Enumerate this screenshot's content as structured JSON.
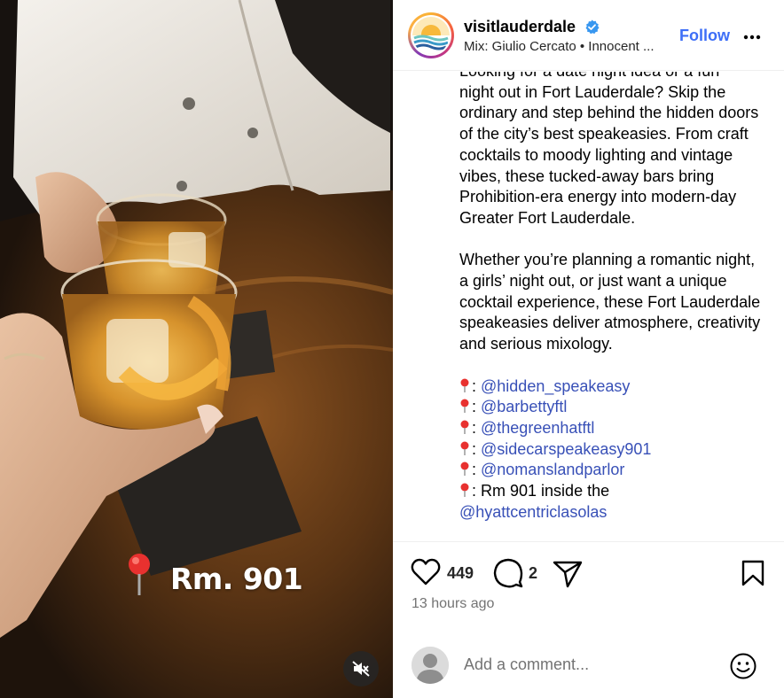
{
  "media": {
    "overlay_text": "Rm. 901",
    "overlay_icon": "round-pushpin-icon",
    "mute_icon": "speaker-muted-icon"
  },
  "header": {
    "username": "visitlauderdale",
    "verified_icon": "verified-badge-icon",
    "subline": "Mix: Giulio Cercato • Innocent ...",
    "follow_label": "Follow",
    "more_icon": "more-horizontal-icon",
    "accent_color": "#3d6ef7"
  },
  "caption": {
    "partial_top_line": "Looking for a date night idea or a fun",
    "paragraph_1": "night out in Fort Lauderdale? Skip the ordinary and step behind the hidden doors of the city’s best speakeasies. From craft cocktails to moody lighting and vintage vibes, these tucked-away bars bring Prohibition-era energy into modern-day Greater Fort Lauderdale.",
    "paragraph_2": "Whether you’re planning a romantic night, a girls’ night out, or just want a unique cocktail experience, these Fort Lauderdale speakeasies deliver atmosphere, creativity and serious mixology.",
    "list_separator": ": ",
    "mentions": [
      "@hidden_speakeasy",
      "@barbettyftl",
      "@thegreenhatftl",
      "@sidecarspeakeasy901",
      "@nomanslandparlor"
    ],
    "last_item_text": "Rm 901 inside the",
    "last_item_mention": "@hyattcentriclasolas",
    "mention_color": "#3850b7"
  },
  "actions": {
    "like_icon": "heart-icon",
    "like_count": "449",
    "comment_icon": "comment-bubble-icon",
    "comment_count": "2",
    "share_icon": "paper-plane-icon",
    "save_icon": "bookmark-icon",
    "timestamp": "13 hours ago"
  },
  "comment_box": {
    "placeholder": "Add a comment...",
    "emoji_icon": "smiley-face-icon"
  }
}
